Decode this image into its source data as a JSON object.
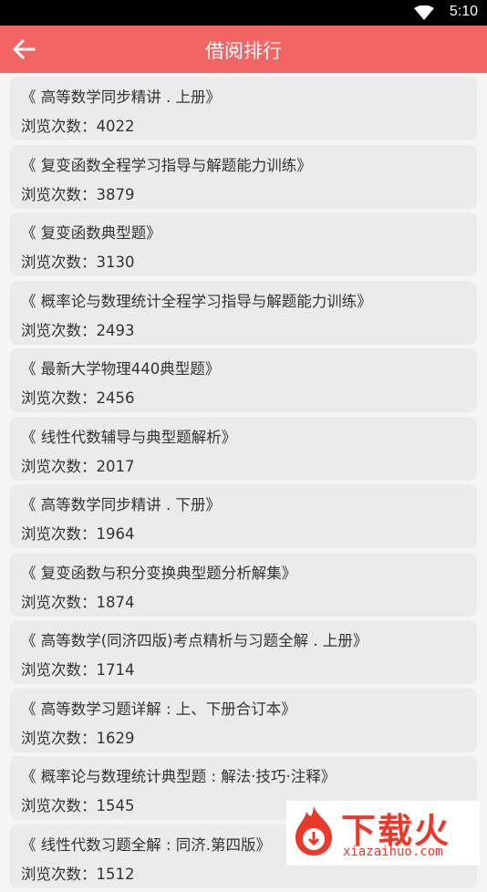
{
  "status_bar": {
    "time": "5:10"
  },
  "app_bar": {
    "title": "借阅排行"
  },
  "count_label": "浏览次数：",
  "books": [
    {
      "title": "《 高等数学同步精讲 . 上册》",
      "count": "4022"
    },
    {
      "title": "《 复变函数全程学习指导与解题能力训练》",
      "count": "3879"
    },
    {
      "title": "《 复变函数典型题》",
      "count": "3130"
    },
    {
      "title": "《 概率论与数理统计全程学习指导与解题能力训练》",
      "count": "2493"
    },
    {
      "title": "《 最新大学物理440典型题》",
      "count": "2456"
    },
    {
      "title": "《 线性代数辅导与典型题解析》",
      "count": "2017"
    },
    {
      "title": "《 高等数学同步精讲 . 下册》",
      "count": "1964"
    },
    {
      "title": "《 复变函数与积分变换典型题分析解集》",
      "count": "1874"
    },
    {
      "title": "《 高等数学(同济四版)考点精析与习题全解 . 上册》",
      "count": "1714"
    },
    {
      "title": "《 高等数学习题详解 : 上、下册合订本》",
      "count": "1629"
    },
    {
      "title": "《 概率论与数理统计典型题 : 解法·技巧·注释》",
      "count": "1545"
    },
    {
      "title": "《 线性代数习题全解 : 同济.第四版》",
      "count": "1512"
    }
  ],
  "watermark": {
    "brand": "下载火",
    "url": "xiazaihuo.com"
  },
  "colors": {
    "app_bar": "#f36464",
    "card": "#ebebeb",
    "background": "#f5f5f5"
  }
}
